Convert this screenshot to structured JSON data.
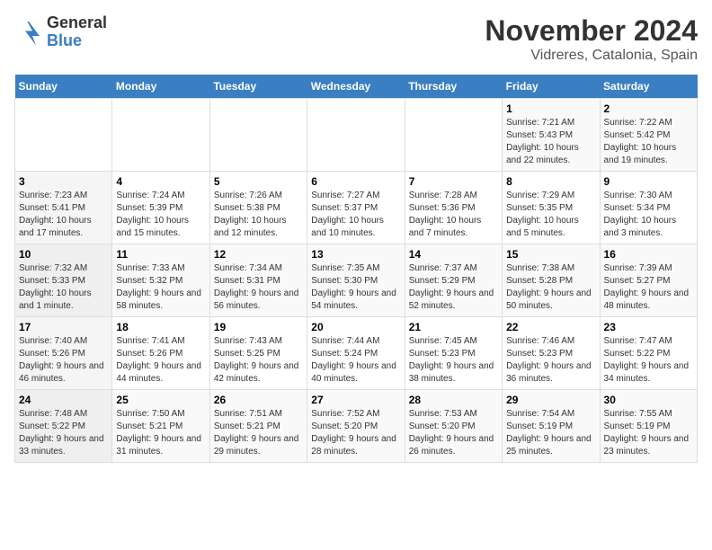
{
  "header": {
    "logo_line1": "General",
    "logo_line2": "Blue",
    "month": "November 2024",
    "location": "Vidreres, Catalonia, Spain"
  },
  "weekdays": [
    "Sunday",
    "Monday",
    "Tuesday",
    "Wednesday",
    "Thursday",
    "Friday",
    "Saturday"
  ],
  "weeks": [
    [
      {
        "day": "",
        "info": ""
      },
      {
        "day": "",
        "info": ""
      },
      {
        "day": "",
        "info": ""
      },
      {
        "day": "",
        "info": ""
      },
      {
        "day": "",
        "info": ""
      },
      {
        "day": "1",
        "info": "Sunrise: 7:21 AM\nSunset: 5:43 PM\nDaylight: 10 hours and 22 minutes."
      },
      {
        "day": "2",
        "info": "Sunrise: 7:22 AM\nSunset: 5:42 PM\nDaylight: 10 hours and 19 minutes."
      }
    ],
    [
      {
        "day": "3",
        "info": "Sunrise: 7:23 AM\nSunset: 5:41 PM\nDaylight: 10 hours and 17 minutes."
      },
      {
        "day": "4",
        "info": "Sunrise: 7:24 AM\nSunset: 5:39 PM\nDaylight: 10 hours and 15 minutes."
      },
      {
        "day": "5",
        "info": "Sunrise: 7:26 AM\nSunset: 5:38 PM\nDaylight: 10 hours and 12 minutes."
      },
      {
        "day": "6",
        "info": "Sunrise: 7:27 AM\nSunset: 5:37 PM\nDaylight: 10 hours and 10 minutes."
      },
      {
        "day": "7",
        "info": "Sunrise: 7:28 AM\nSunset: 5:36 PM\nDaylight: 10 hours and 7 minutes."
      },
      {
        "day": "8",
        "info": "Sunrise: 7:29 AM\nSunset: 5:35 PM\nDaylight: 10 hours and 5 minutes."
      },
      {
        "day": "9",
        "info": "Sunrise: 7:30 AM\nSunset: 5:34 PM\nDaylight: 10 hours and 3 minutes."
      }
    ],
    [
      {
        "day": "10",
        "info": "Sunrise: 7:32 AM\nSunset: 5:33 PM\nDaylight: 10 hours and 1 minute."
      },
      {
        "day": "11",
        "info": "Sunrise: 7:33 AM\nSunset: 5:32 PM\nDaylight: 9 hours and 58 minutes."
      },
      {
        "day": "12",
        "info": "Sunrise: 7:34 AM\nSunset: 5:31 PM\nDaylight: 9 hours and 56 minutes."
      },
      {
        "day": "13",
        "info": "Sunrise: 7:35 AM\nSunset: 5:30 PM\nDaylight: 9 hours and 54 minutes."
      },
      {
        "day": "14",
        "info": "Sunrise: 7:37 AM\nSunset: 5:29 PM\nDaylight: 9 hours and 52 minutes."
      },
      {
        "day": "15",
        "info": "Sunrise: 7:38 AM\nSunset: 5:28 PM\nDaylight: 9 hours and 50 minutes."
      },
      {
        "day": "16",
        "info": "Sunrise: 7:39 AM\nSunset: 5:27 PM\nDaylight: 9 hours and 48 minutes."
      }
    ],
    [
      {
        "day": "17",
        "info": "Sunrise: 7:40 AM\nSunset: 5:26 PM\nDaylight: 9 hours and 46 minutes."
      },
      {
        "day": "18",
        "info": "Sunrise: 7:41 AM\nSunset: 5:26 PM\nDaylight: 9 hours and 44 minutes."
      },
      {
        "day": "19",
        "info": "Sunrise: 7:43 AM\nSunset: 5:25 PM\nDaylight: 9 hours and 42 minutes."
      },
      {
        "day": "20",
        "info": "Sunrise: 7:44 AM\nSunset: 5:24 PM\nDaylight: 9 hours and 40 minutes."
      },
      {
        "day": "21",
        "info": "Sunrise: 7:45 AM\nSunset: 5:23 PM\nDaylight: 9 hours and 38 minutes."
      },
      {
        "day": "22",
        "info": "Sunrise: 7:46 AM\nSunset: 5:23 PM\nDaylight: 9 hours and 36 minutes."
      },
      {
        "day": "23",
        "info": "Sunrise: 7:47 AM\nSunset: 5:22 PM\nDaylight: 9 hours and 34 minutes."
      }
    ],
    [
      {
        "day": "24",
        "info": "Sunrise: 7:48 AM\nSunset: 5:22 PM\nDaylight: 9 hours and 33 minutes."
      },
      {
        "day": "25",
        "info": "Sunrise: 7:50 AM\nSunset: 5:21 PM\nDaylight: 9 hours and 31 minutes."
      },
      {
        "day": "26",
        "info": "Sunrise: 7:51 AM\nSunset: 5:21 PM\nDaylight: 9 hours and 29 minutes."
      },
      {
        "day": "27",
        "info": "Sunrise: 7:52 AM\nSunset: 5:20 PM\nDaylight: 9 hours and 28 minutes."
      },
      {
        "day": "28",
        "info": "Sunrise: 7:53 AM\nSunset: 5:20 PM\nDaylight: 9 hours and 26 minutes."
      },
      {
        "day": "29",
        "info": "Sunrise: 7:54 AM\nSunset: 5:19 PM\nDaylight: 9 hours and 25 minutes."
      },
      {
        "day": "30",
        "info": "Sunrise: 7:55 AM\nSunset: 5:19 PM\nDaylight: 9 hours and 23 minutes."
      }
    ]
  ]
}
